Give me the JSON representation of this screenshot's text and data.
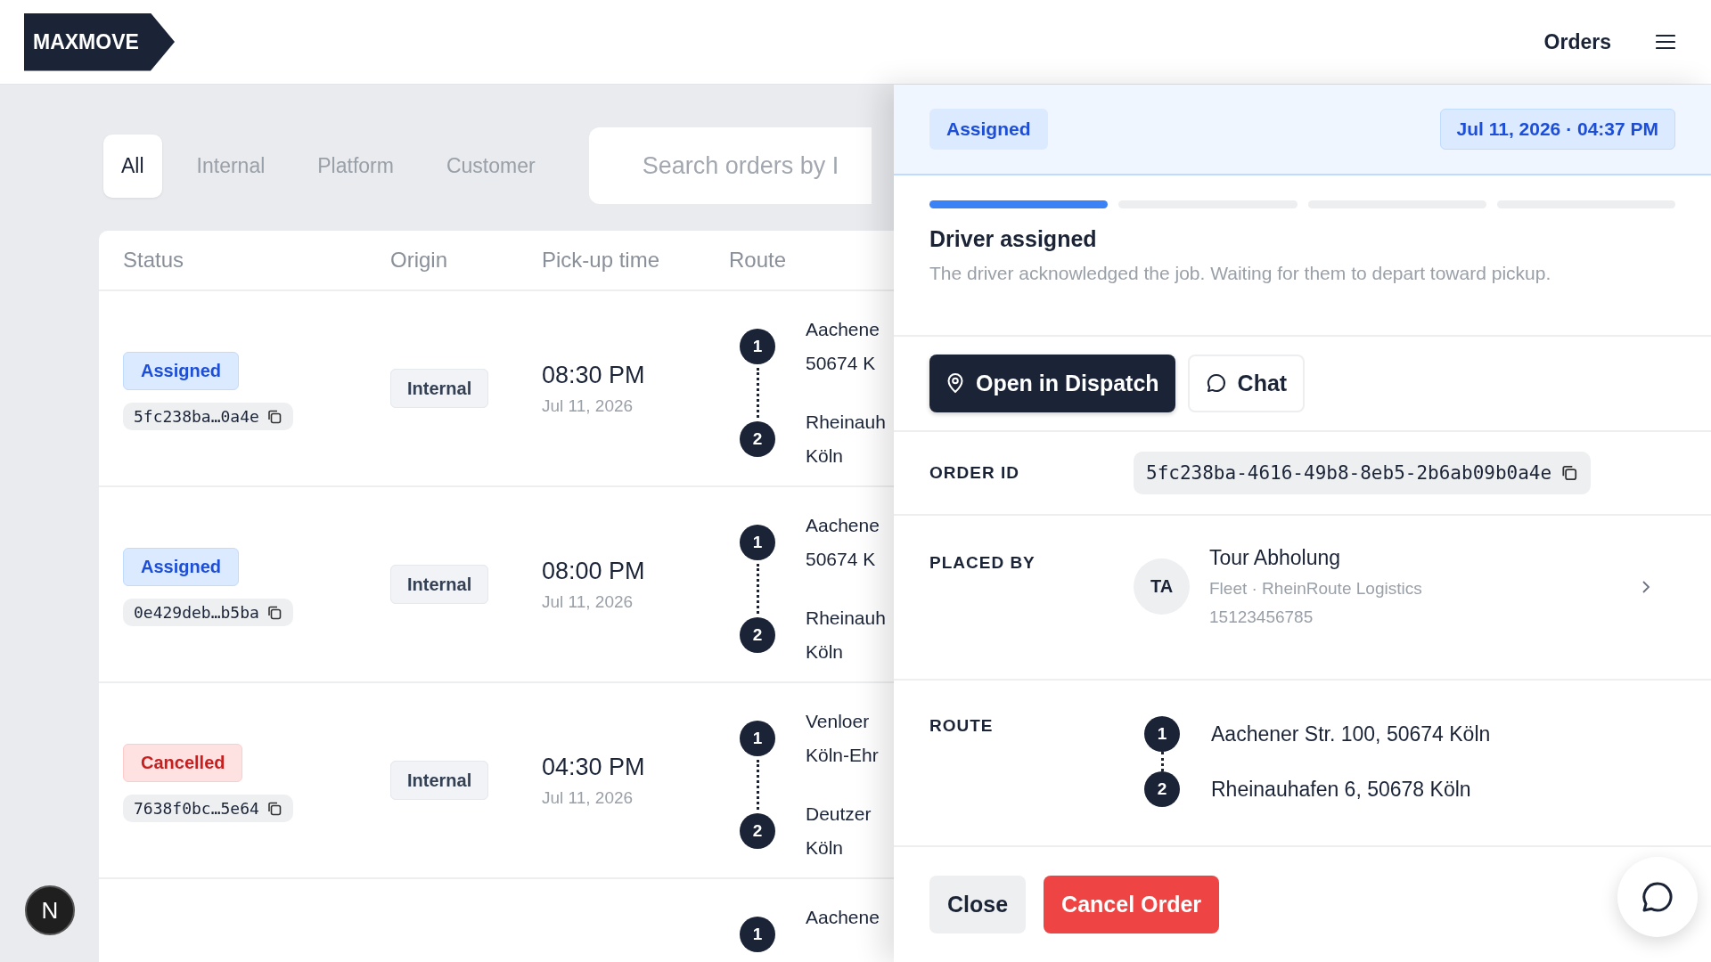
{
  "header": {
    "logo": "MAXMOVE",
    "nav_link": "Orders"
  },
  "filter_tabs": [
    {
      "label": "All",
      "selected": true
    },
    {
      "label": "Internal",
      "selected": false
    },
    {
      "label": "Platform",
      "selected": false
    },
    {
      "label": "Customer",
      "selected": false
    }
  ],
  "search": {
    "placeholder": "Search orders by I"
  },
  "table": {
    "columns": [
      "Status",
      "Origin",
      "Pick-up time",
      "Route"
    ],
    "rows": [
      {
        "status": {
          "label": "Assigned",
          "kind": "assigned"
        },
        "order_id": "5fc238ba…0a4e",
        "origin": "Internal",
        "time": "08:30 PM",
        "date": "Jul 11, 2026",
        "route": [
          {
            "number": "1",
            "lines": [
              "Aachene",
              "50674 K"
            ]
          },
          {
            "number": "2",
            "lines": [
              "Rheinauh",
              "Köln"
            ]
          }
        ]
      },
      {
        "status": {
          "label": "Assigned",
          "kind": "assigned"
        },
        "order_id": "0e429deb…b5ba",
        "origin": "Internal",
        "time": "08:00 PM",
        "date": "Jul 11, 2026",
        "route": [
          {
            "number": "1",
            "lines": [
              "Aachene",
              "50674 K"
            ]
          },
          {
            "number": "2",
            "lines": [
              "Rheinauh",
              "Köln"
            ]
          }
        ]
      },
      {
        "status": {
          "label": "Cancelled",
          "kind": "cancelled"
        },
        "order_id": "7638f0bc…5e64",
        "origin": "Internal",
        "time": "04:30 PM",
        "date": "Jul 11, 2026",
        "route": [
          {
            "number": "1",
            "lines": [
              "Venloer",
              "Köln-Ehr"
            ]
          },
          {
            "number": "2",
            "lines": [
              "Deutzer",
              "Köln"
            ]
          }
        ]
      },
      {
        "route": [
          {
            "number": "1",
            "lines": [
              "Aachene"
            ]
          }
        ]
      }
    ]
  },
  "detail": {
    "status": {
      "label": "Assigned",
      "kind": "assigned"
    },
    "timestamp": "Jul 11, 2026 · 04:37 PM",
    "steps": [
      {
        "done": true
      },
      {
        "done": false
      },
      {
        "done": false
      },
      {
        "done": false
      }
    ],
    "step_title": "Driver assigned",
    "step_description": "The driver acknowledged the job. Waiting for them to depart toward pickup.",
    "actions": [
      {
        "label": "Open in Dispatch",
        "kind": "primary"
      },
      {
        "label": "Chat",
        "kind": "secondary"
      }
    ],
    "order_id": {
      "label": "ORDER ID",
      "value": "5fc238ba-4616-49b8-8eb5-2b6ab09b0a4e"
    },
    "placed_by": {
      "label": "PLACED BY",
      "initials": "TA",
      "name": "Tour Abholung",
      "subtitle": "Fleet · RheinRoute Logistics",
      "phone": "15123456785"
    },
    "route": {
      "label": "ROUTE",
      "stops": [
        {
          "number": "1",
          "address": "Aachener Str. 100, 50674 Köln"
        },
        {
          "number": "2",
          "address": "Rheinauhafen 6, 50678 Köln"
        }
      ]
    },
    "footer_buttons": [
      {
        "label": "Close",
        "kind": "secondary"
      },
      {
        "label": "Cancel Order",
        "kind": "danger"
      }
    ]
  },
  "floating": {
    "avatar": "N"
  }
}
